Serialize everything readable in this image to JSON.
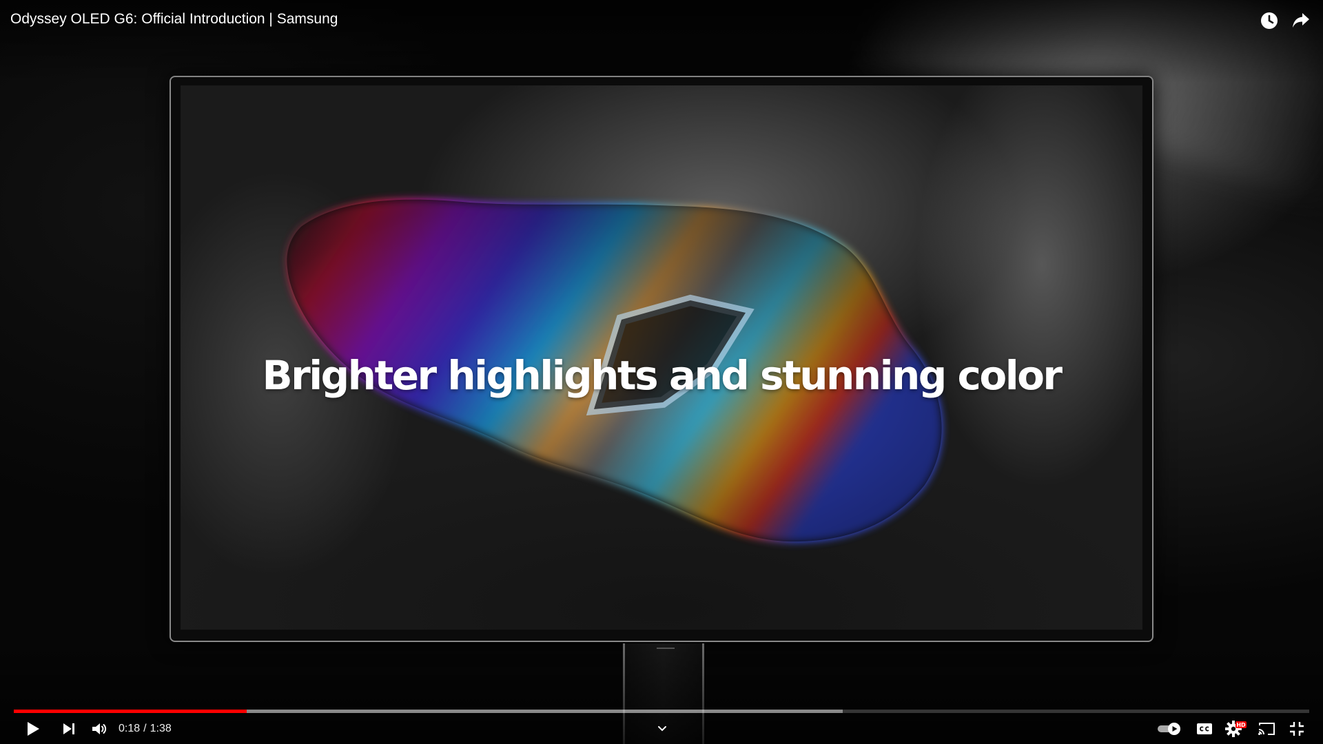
{
  "player": {
    "title": "Odyssey OLED G6: Official Introduction | Samsung",
    "caption": "Brighter highlights and stunning color",
    "time": {
      "current": "0:18",
      "separator": "/",
      "duration": "1:38"
    },
    "progress": {
      "played_fraction": 0.18,
      "buffered_fraction": 0.64
    },
    "accent_color": "#ff0000",
    "autoplay_on": true,
    "quality_badge": "HD"
  },
  "icons": {
    "watch_later": "clock-icon",
    "share": "share-icon",
    "play": "play-icon",
    "next": "next-icon",
    "volume": "volume-icon",
    "chevron": "chevron-down-icon",
    "autoplay": "autoplay-toggle-icon",
    "captions": "captions-icon",
    "settings": "gear-icon",
    "cast": "cast-icon",
    "fullscreen": "exit-fullscreen-icon"
  }
}
